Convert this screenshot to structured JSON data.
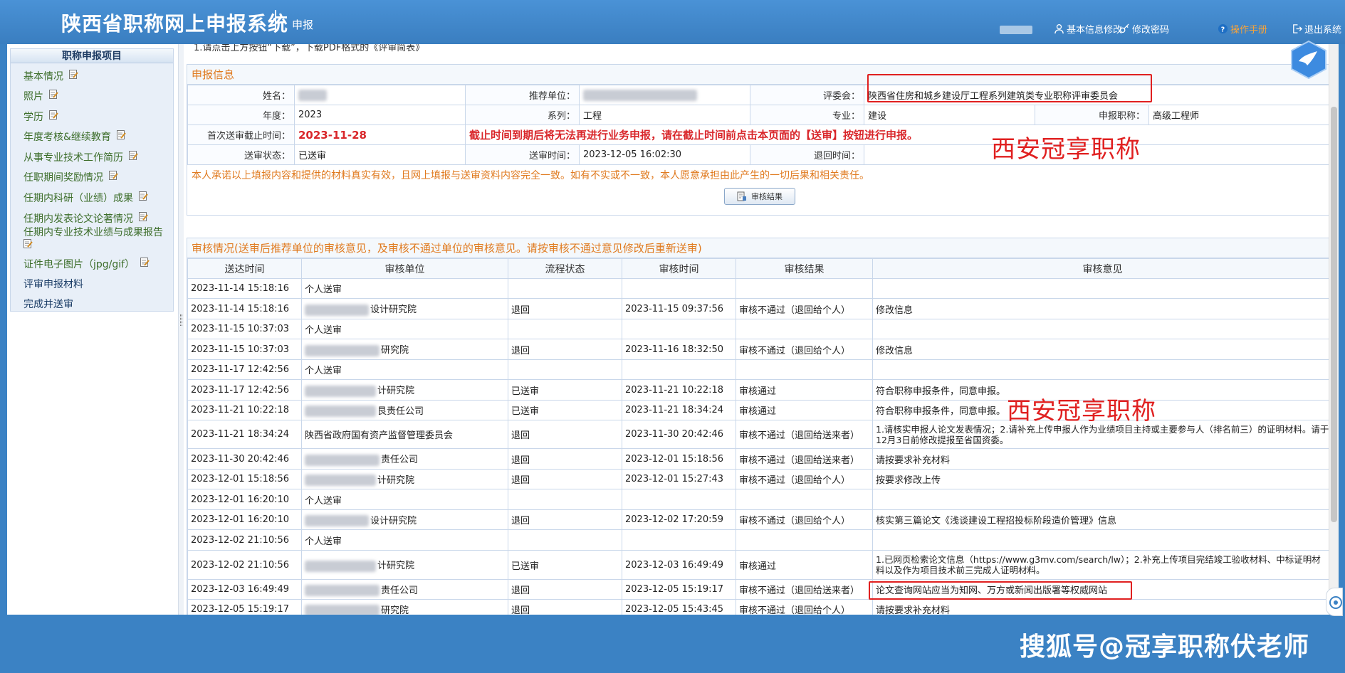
{
  "header": {
    "title": "陕西省职称网上申报系统",
    "subtitle": "申报",
    "nav": {
      "profile": "基本信息修改",
      "password": "修改密码",
      "manual": "操作手册",
      "logout": "退出系统"
    }
  },
  "sidebar": {
    "title": "职称申报项目",
    "items": [
      {
        "label": "基本情况"
      },
      {
        "label": "照片"
      },
      {
        "label": "学历"
      },
      {
        "label": "年度考核&继续教育"
      },
      {
        "label": "从事专业技术工作简历"
      },
      {
        "label": "任职期间奖励情况"
      },
      {
        "label": "任期内科研（业绩）成果"
      },
      {
        "label": "任期内发表论文论著情况"
      },
      {
        "label": "任期内专业技术业绩与成果报告"
      },
      {
        "label": "证件电子图片（jpg/gif）"
      },
      {
        "label": "评审申报材料"
      },
      {
        "label": "完成并送审"
      }
    ]
  },
  "top_note": "1.请点击上方按钮“下载”，下载PDF格式的《评审简表》",
  "info": {
    "title": "申报信息",
    "name_label": "姓名：",
    "unit_label": "推荐单位：",
    "committee_label": "评委会：",
    "committee": "陕西省住房和城乡建设厅工程系列建筑类专业职称评审委员会",
    "year_label": "年度：",
    "year": "2023",
    "series_label": "系列：",
    "series": "工程",
    "major_label": "专业：",
    "major": "建设",
    "title_label": "申报职称：",
    "title_value": "高级工程师",
    "deadline_label": "首次送审截止时间：",
    "deadline": "2023-11-28",
    "deadline_notice": "截止时间到期后将无法再进行业务申报，请在截止时间前点击本页面的【送审】按钮进行申报。",
    "status_label": "送审状态：",
    "status": "已送审",
    "submit_time_label": "送审时间：",
    "submit_time": "2023-12-05 16:02:30",
    "return_time_label": "退回时间：",
    "return_time": "",
    "pledge": "本人承诺以上填报内容和提供的材料真实有效，且网上填报与送审资料内容完全一致。如有不实或不一致，本人愿意承担由此产生的一切后果和相关责任。",
    "button": "审核结果"
  },
  "audit": {
    "title": "审核情况(送审后推荐单位的审核意见，及审核不通过单位的审核意见。请按审核不通过意见修改后重新送审)",
    "columns": [
      "送达时间",
      "审核单位",
      "流程状态",
      "审核时间",
      "审核结果",
      "审核意见"
    ],
    "rows": [
      {
        "sent": "2023-11-14 15:18:16",
        "unit": "个人送审",
        "state": "",
        "time": "",
        "result": "",
        "opinion": ""
      },
      {
        "sent": "2023-11-14 15:18:16",
        "unit": "设计研究院",
        "state": "退回",
        "time": "2023-11-15 09:37:56",
        "result": "审核不通过（退回给个人）",
        "opinion": "修改信息"
      },
      {
        "sent": "2023-11-15 10:37:03",
        "unit": "个人送审",
        "state": "",
        "time": "",
        "result": "",
        "opinion": ""
      },
      {
        "sent": "2023-11-15 10:37:03",
        "unit": "研究院",
        "state": "退回",
        "time": "2023-11-16 18:32:50",
        "result": "审核不通过（退回给个人）",
        "opinion": "修改信息"
      },
      {
        "sent": "2023-11-17 12:42:56",
        "unit": "个人送审",
        "state": "",
        "time": "",
        "result": "",
        "opinion": ""
      },
      {
        "sent": "2023-11-17 12:42:56",
        "unit": "计研究院",
        "state": "已送审",
        "time": "2023-11-21 10:22:18",
        "result": "审核通过",
        "opinion": "符合职称申报条件，同意申报。"
      },
      {
        "sent": "2023-11-21 10:22:18",
        "unit": "艮责任公司",
        "state": "已送审",
        "time": "2023-11-21 18:34:24",
        "result": "审核通过",
        "opinion": "符合职称申报条件，同意申报。"
      },
      {
        "sent": "2023-11-21 18:34:24",
        "unit": "陕西省政府国有资产监督管理委员会",
        "state": "退回",
        "time": "2023-11-30 20:42:46",
        "result": "审核不通过（退回给送来者）",
        "opinion": "1.请核实申报人论文发表情况；2.请补充上传申报人作为业绩项目主持或主要参与人（排名前三）的证明材料。请于12月3日前修改提报至省国资委。"
      },
      {
        "sent": "2023-11-30 20:42:46",
        "unit": "责任公司",
        "state": "退回",
        "time": "2023-12-01 15:18:56",
        "result": "审核不通过（退回给送来者）",
        "opinion": "请按要求补充材料"
      },
      {
        "sent": "2023-12-01 15:18:56",
        "unit": "计研究院",
        "state": "退回",
        "time": "2023-12-01 15:27:43",
        "result": "审核不通过（退回给个人）",
        "opinion": "按要求修改上传"
      },
      {
        "sent": "2023-12-01 16:20:10",
        "unit": "个人送审",
        "state": "",
        "time": "",
        "result": "",
        "opinion": ""
      },
      {
        "sent": "2023-12-01 16:20:10",
        "unit": "设计研究院",
        "state": "退回",
        "time": "2023-12-02 17:20:59",
        "result": "审核不通过（退回给个人）",
        "opinion": "核实第三篇论文《浅谈建设工程招投标阶段造价管理》信息"
      },
      {
        "sent": "2023-12-02 21:10:56",
        "unit": "个人送审",
        "state": "",
        "time": "",
        "result": "",
        "opinion": ""
      },
      {
        "sent": "2023-12-02 21:10:56",
        "unit": "计研究院",
        "state": "已送审",
        "time": "2023-12-03 16:49:49",
        "result": "审核通过",
        "opinion": "1.已网页检索论文信息（https://www.g3mv.com/search/lw）；2.补充上传项目完结竣工验收材料、中标证明材料以及作为项目技术前三完成人证明材料。"
      },
      {
        "sent": "2023-12-03 16:49:49",
        "unit": "责任公司",
        "state": "退回",
        "time": "2023-12-05 15:19:17",
        "result": "审核不通过（退回给送来者）",
        "opinion": "论文查询网站应当为知网、万方或新闻出版署等权威网站"
      },
      {
        "sent": "2023-12-05 15:19:17",
        "unit": "研究院",
        "state": "退回",
        "time": "2023-12-05 15:43:45",
        "result": "审核不通过（退回给个人）",
        "opinion": "请按要求补充材料"
      }
    ]
  },
  "watermarks": {
    "red": "西安冠享职称",
    "footer": "搜狐号@冠享职称伏老师"
  },
  "colors": {
    "header_bg": "#3b82c4",
    "accent_orange": "#e07a1f",
    "alert_red": "#d9262a"
  }
}
